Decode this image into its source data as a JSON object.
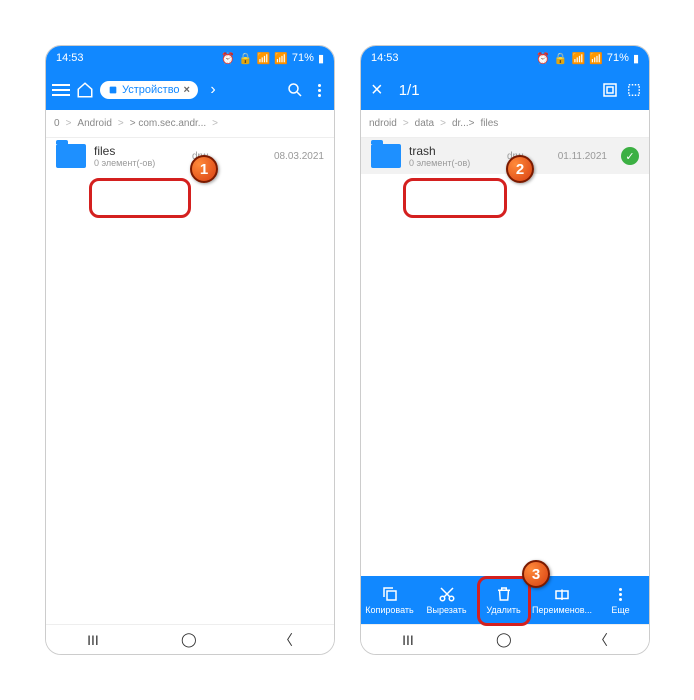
{
  "status": {
    "time": "14:53",
    "battery": "71%"
  },
  "left": {
    "chip_label": "Устройство",
    "breadcrumb": [
      "0",
      ">",
      "Android",
      ">",
      "",
      "> com.sec.andr...",
      ">"
    ],
    "file": {
      "name": "files",
      "sub": "0 элемент(-ов)",
      "perm": "drw",
      "date": "08.03.2021"
    }
  },
  "right": {
    "selection": "1/1",
    "breadcrumb": [
      "ndroid",
      ">",
      "data",
      ">",
      "",
      "dr...>",
      "files"
    ],
    "file": {
      "name": "trash",
      "sub": "0 элемент(-ов)",
      "perm": "drw",
      "date": "01.11.2021"
    },
    "actions": {
      "copy": "Копировать",
      "cut": "Вырезать",
      "delete": "Удалить",
      "rename": "Переименов...",
      "more": "Еще"
    }
  },
  "markers": {
    "m1": "1",
    "m2": "2",
    "m3": "3"
  }
}
